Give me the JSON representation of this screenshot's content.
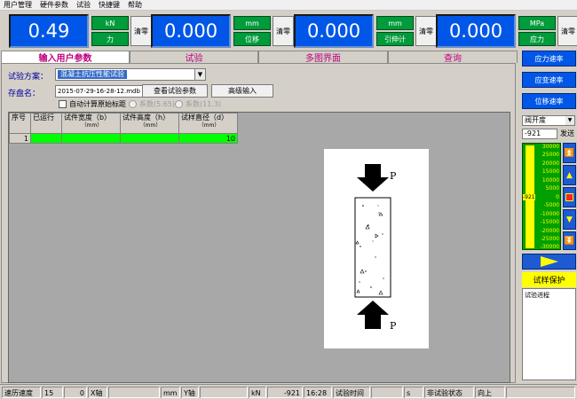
{
  "menu": [
    "用户管理",
    "硬件参数",
    "试验",
    "快捷键",
    "帮助"
  ],
  "readouts": [
    {
      "value": "0.49",
      "unit": "kN",
      "kind": "力",
      "zero": "清零"
    },
    {
      "value": "0.000",
      "unit": "mm",
      "kind": "位移",
      "zero": "清零"
    },
    {
      "value": "0.000",
      "unit": "mm",
      "kind": "引伸计",
      "zero": "清零"
    },
    {
      "value": "0.000",
      "unit": "MPa",
      "kind": "应力",
      "zero": "清零"
    }
  ],
  "tabs": [
    "输入用户参数",
    "试验",
    "多图界面",
    "查询"
  ],
  "form": {
    "scheme_label": "试验方案：",
    "scheme_value": "混凝土抗压性能试验",
    "file_label": "存盘名：",
    "file_value": "2015-07-29-16-28-12.mdb",
    "view_params_button": "查看试验参数",
    "advanced_button": "高级输入",
    "auto_calc_label": "自动计算原始标距",
    "coef_a_label": "系数(5.65)",
    "coef_b_label": "系数(11.3)"
  },
  "grid": {
    "columns": [
      {
        "title": "序号",
        "sub": ""
      },
      {
        "title": "已运行",
        "sub": ""
      },
      {
        "title": "试件宽度（b）",
        "sub": "（mm）"
      },
      {
        "title": "试件高度（h）",
        "sub": "（mm）"
      },
      {
        "title": "试样直径（d）",
        "sub": "（mm）"
      }
    ],
    "rows": [
      {
        "no": "1",
        "ran": "",
        "width": "",
        "height": "",
        "diameter": "10"
      }
    ]
  },
  "specimen": {
    "load_label": "P"
  },
  "right_panel": {
    "buttons": [
      "应力速率",
      "应变速率",
      "位移速率"
    ],
    "control_mode": "阀开度",
    "value": "-921",
    "send": "发送",
    "gauge_ticks": [
      "30000",
      "25000",
      "20000",
      "15000",
      "10000",
      "5000",
      "0",
      "-5000",
      "-10000",
      "-15000",
      "-20000",
      "-25000",
      "-30000"
    ],
    "gauge_current": "-921",
    "protect": "试样保护",
    "progress_label": "试验进程"
  },
  "status": {
    "speed_label": "速历速度",
    "speed_value": "15",
    "x_value": "0",
    "x_label": "X轴",
    "x_unit": "mm",
    "y_label": "Y轴",
    "y_unit": "kN",
    "y_value": "-921",
    "time": "16:28",
    "time_label": "试验时间",
    "time_unit": "s",
    "state": "非试验状态",
    "state2": "向上"
  },
  "colors": {
    "display": "#0057e7",
    "unit_bg": "#009b3a",
    "tab_text": "#c0007f",
    "grid_row": "#00ff00",
    "protect": "#ffff00"
  }
}
